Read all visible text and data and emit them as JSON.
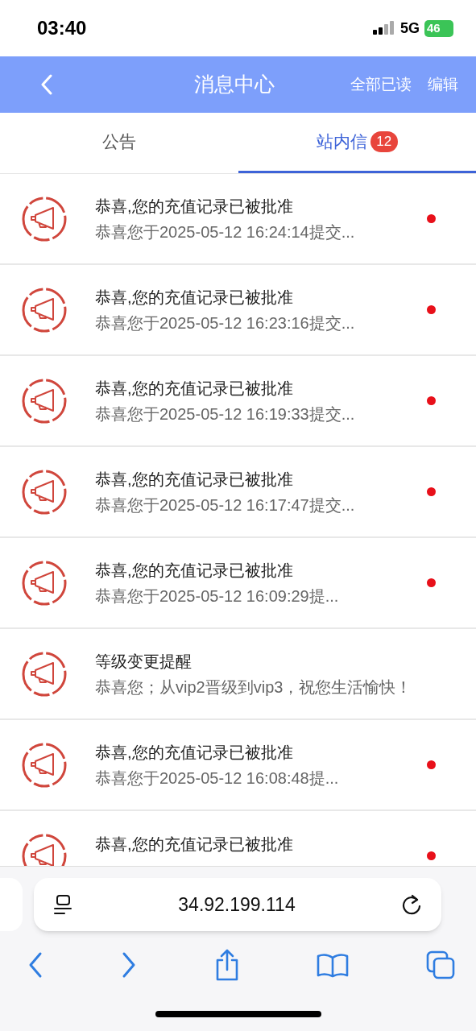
{
  "status_bar": {
    "time": "03:40",
    "network": "5G",
    "battery": "46"
  },
  "header": {
    "title": "消息中心",
    "actions": [
      "全部已读",
      "编辑"
    ]
  },
  "tabs": [
    {
      "label": "公告",
      "selected": false
    },
    {
      "label": "站内信",
      "selected": true,
      "badge": "12"
    }
  ],
  "messages": [
    {
      "title": "恭喜,您的充值记录已被批准",
      "preview": "恭喜您于2025-05-12 16:24:14提交...",
      "unread": true
    },
    {
      "title": "恭喜,您的充值记录已被批准",
      "preview": "恭喜您于2025-05-12 16:23:16提交...",
      "unread": true
    },
    {
      "title": "恭喜,您的充值记录已被批准",
      "preview": "恭喜您于2025-05-12 16:19:33提交...",
      "unread": true
    },
    {
      "title": "恭喜,您的充值记录已被批准",
      "preview": "恭喜您于2025-05-12 16:17:47提交...",
      "unread": true
    },
    {
      "title": "恭喜,您的充值记录已被批准",
      "preview": "恭喜您于2025-05-12 16:09:29提...",
      "unread": true
    },
    {
      "title": "等级变更提醒",
      "preview": "恭喜您；从vip2晋级到vip3，祝您生活愉快！",
      "unread": false
    },
    {
      "title": "恭喜,您的充值记录已被批准",
      "preview": "恭喜您于2025-05-12 16:08:48提...",
      "unread": true
    },
    {
      "title": "恭喜,您的充值记录已被批准",
      "unread": true
    }
  ],
  "browser": {
    "url": "34.92.199.114"
  }
}
